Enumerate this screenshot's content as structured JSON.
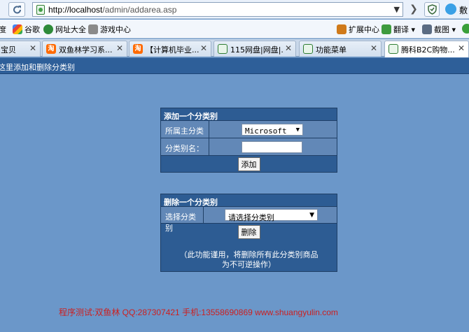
{
  "browser": {
    "url_host": "http://localhost",
    "url_path": "/admin/addarea.asp",
    "user_label": "敷"
  },
  "bookmarks": [
    {
      "label": "度"
    },
    {
      "label": "谷歌"
    },
    {
      "label": "网址大全"
    },
    {
      "label": "游戏中心"
    },
    {
      "label": "扩展中心"
    },
    {
      "label": "翻译"
    },
    {
      "label": "截图"
    }
  ],
  "tabs": [
    {
      "label": "宝贝",
      "favicon": ""
    },
    {
      "label": "双鱼林学习系...",
      "favicon": "淘"
    },
    {
      "label": "【计算机毕业...",
      "favicon": "淘"
    },
    {
      "label": "115网盘|网盘|...",
      "favicon": ""
    },
    {
      "label": "功能菜单",
      "favicon": ""
    },
    {
      "label": "腾科B2C购物...",
      "favicon": ""
    }
  ],
  "page": {
    "header": "这里添加和删除分类别",
    "add_panel": {
      "title": "添加一个分类别",
      "parent_label": "所属主分类",
      "parent_value": "Microsoft",
      "name_label": "分类别名：",
      "name_value": "",
      "submit": "添加"
    },
    "del_panel": {
      "title": "删除一个分类别",
      "select_label": "选择分类别",
      "select_value": "请选择分类别",
      "submit": "删除",
      "note_line1": "（此功能谨用，将删除所有此分类别商品",
      "note_line2": "为不可逆操作）"
    },
    "footer": "程序测试:双鱼林 QQ:287307421 手机:13558690869 www.shuangyulin.com"
  }
}
